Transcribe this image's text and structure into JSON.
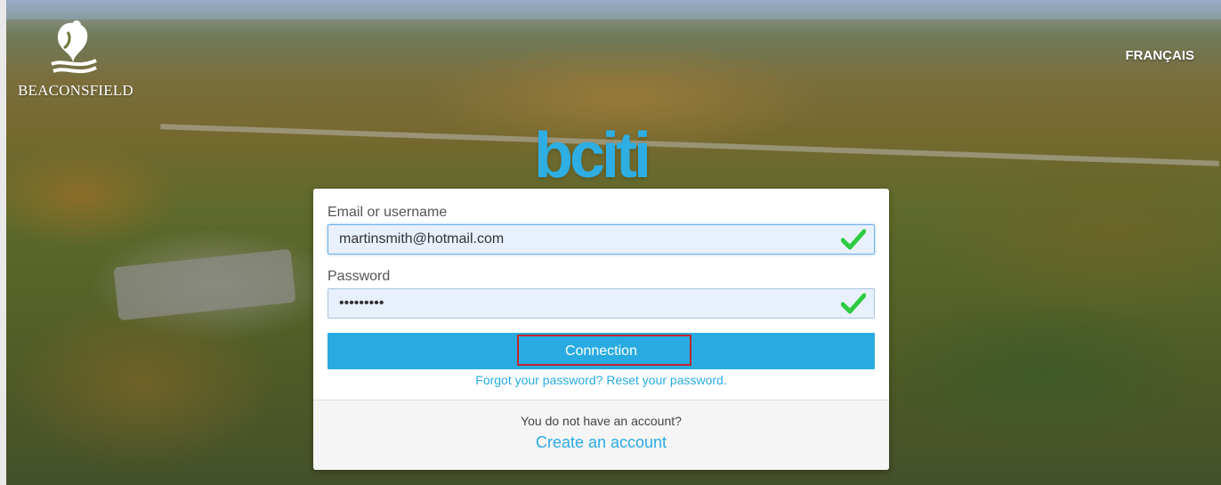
{
  "header": {
    "logo_text": "BEACONSFIELD",
    "language_link": "FRANÇAIS"
  },
  "brand": {
    "name": "bciti",
    "color": "#2eaee3"
  },
  "login": {
    "email_label": "Email or username",
    "email_value": "martinsmith@hotmail.com",
    "password_label": "Password",
    "password_value": "•••••••••",
    "submit_label": "Connection",
    "forgot_link": "Forgot your password? Reset your password.",
    "no_account_text": "You do not have an account?",
    "create_account_link": "Create an account",
    "email_valid_icon": "checkmark-icon",
    "password_valid_icon": "checkmark-icon"
  },
  "colors": {
    "accent": "#29abe2",
    "valid_check": "#2ecc40",
    "highlight_outline": "#c0262c"
  }
}
